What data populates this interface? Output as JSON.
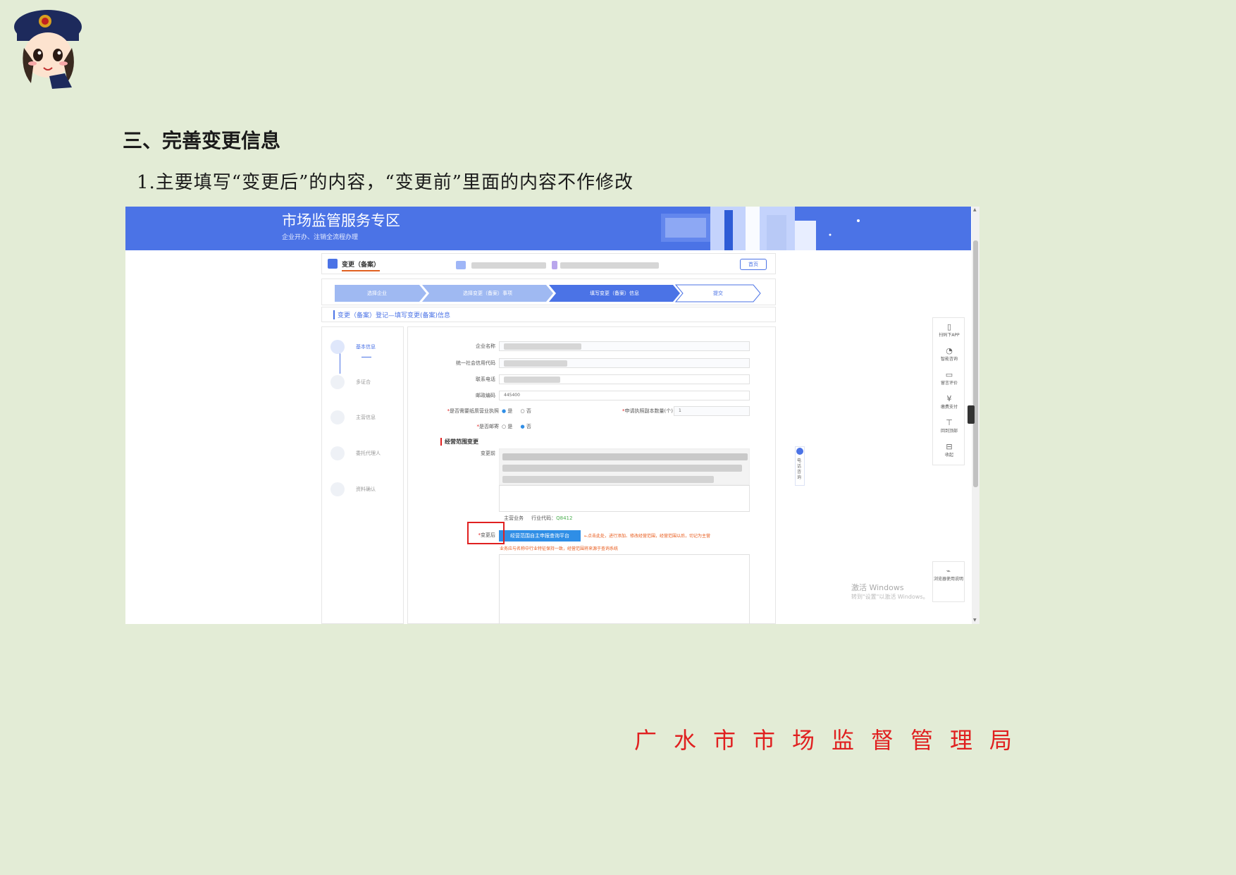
{
  "heading": "三、完善变更信息",
  "instruction": "1.主要填写“变更后”的内容，“变更前”里面的内容不作修改",
  "footer": "广水市市场监督管理局",
  "screenshot": {
    "banner": {
      "title": "市场监管服务专区",
      "subtitle": "企业开办、注销全流程办理"
    },
    "topbar": {
      "title": "变更（备案）",
      "home_button": "首页"
    },
    "steps": [
      "选择企业",
      "选择变更（备案）事项",
      "填写变更（备案）信息",
      "提交"
    ],
    "section_title": "变更（备案）登记—填写变更(备案)信息",
    "side_nav": [
      "基本信息",
      "多证合",
      "主营信息",
      "委托代理人",
      "资料确认"
    ],
    "form": {
      "company_name_label": "企业名称",
      "credit_code_label": "统一社会信用代码",
      "phone_label": "联系电话",
      "postcode_label": "邮政编码",
      "postcode_value": "445400",
      "paper_license_label": "是否需要纸质营业执照",
      "paper_license_yes": "是",
      "paper_license_no": "否",
      "copies_label": "申请执照副本数量(个)",
      "copies_value": "1",
      "mailing_label": "是否邮寄",
      "mailing_yes": "是",
      "mailing_no": "否",
      "scope_section": "经营范围变更",
      "scope_before_label": "变更前",
      "main_business_label": "主营业务",
      "industry_code_label": "行业代码：",
      "industry_code": "Q8412",
      "scope_after_label": "变更后",
      "query_button": "经营范围自主申报查询平台",
      "note_1": "←点击此处，进行添加、修改经营范围，经营范围以后，切记为主营",
      "note_2": "业务应与名称中行业特征保持一致，经营范围将来源于查询系统"
    },
    "right_panel": [
      "扫码下APP",
      "智能咨询",
      "留言评价",
      "缴费支付",
      "回到顶部",
      "收起"
    ],
    "help_label": "电话咨询",
    "browser_note": "浏览器使用说明",
    "watermark_title": "激活 Windows",
    "watermark_sub": "转到\"设置\"以激活 Windows。"
  },
  "colors": {
    "page_bg": "#e3ecd6",
    "banner": "#4b73e6",
    "accent_red": "#e02020",
    "note_orange": "#e85a1a"
  }
}
